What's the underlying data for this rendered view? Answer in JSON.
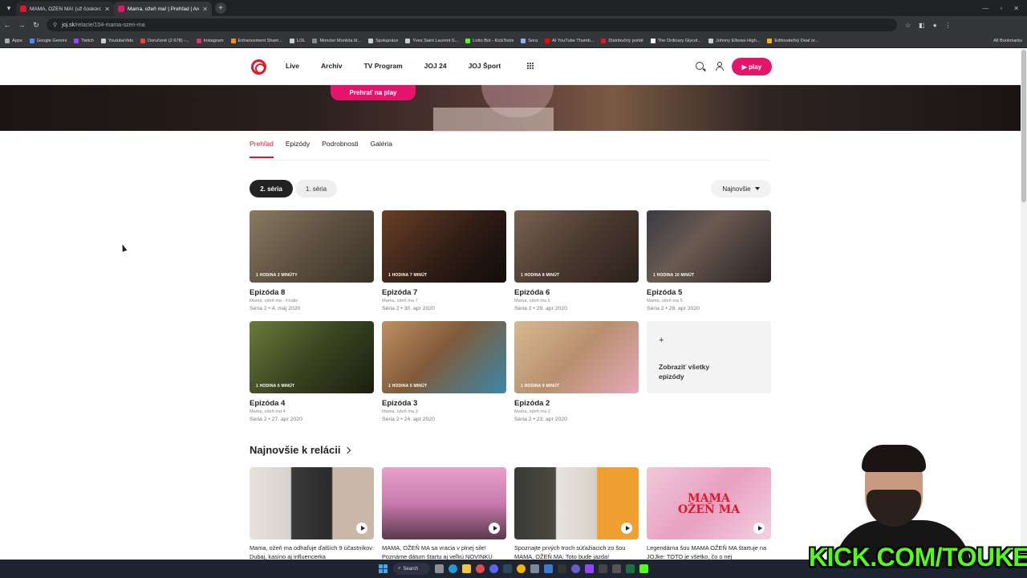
{
  "browser": {
    "tabs": [
      {
        "title": "MAMA, OŽEŇ MA! (už čoskoro",
        "active": false,
        "fav_color": "#e2162a"
      },
      {
        "title": "Mama, ožeň ma! | Prehľad | Arc",
        "active": true,
        "fav_color": "#e6156c"
      }
    ],
    "url_host": "joj.sk",
    "url_path": "/relacie/104-mama-ozen-ma",
    "bookmarks": [
      {
        "label": "Apps",
        "color": "#aaaaaa"
      },
      {
        "label": "Google Gemini",
        "color": "#4b8bf5"
      },
      {
        "label": "Twitch",
        "color": "#9146ff"
      },
      {
        "label": "YoutubeVids",
        "color": "#cccccc"
      },
      {
        "label": "Doručené (2 678) -...",
        "color": "#ea4335"
      },
      {
        "label": "Instagram",
        "color": "#e1306c"
      },
      {
        "label": "Enhancement Sham...",
        "color": "#f28b30"
      },
      {
        "label": "LOL",
        "color": "#cccccc"
      },
      {
        "label": "Moncler Montcla bl...",
        "color": "#888888"
      },
      {
        "label": "Spolupráce",
        "color": "#cccccc"
      },
      {
        "label": "Yves Saint Laurent S...",
        "color": "#cccccc"
      },
      {
        "label": "Lotto Bot - KickTools",
        "color": "#53fc18"
      },
      {
        "label": "Sora",
        "color": "#8ab4f8"
      },
      {
        "label": "AI YouTube Thumb...",
        "color": "#ff0000"
      },
      {
        "label": "Distribučný portál",
        "color": "#e2162a"
      },
      {
        "label": "The Ordinary Glycol...",
        "color": "#ffffff"
      },
      {
        "label": "Johnny Elbows High...",
        "color": "#cccccc"
      },
      {
        "label": "Editovateľný Deal or...",
        "color": "#f4b400"
      }
    ],
    "all_bookmarks": "All Bookmarks"
  },
  "header": {
    "nav": [
      "Live",
      "Archív",
      "TV Program",
      "JOJ 24",
      "JOJ Šport"
    ],
    "play_label": "play",
    "accent": "#e6156c",
    "brand_red": "#e2162a"
  },
  "hero": {
    "button_label": "Prehrať na  play"
  },
  "subtabs": [
    "Prehľad",
    "Epizódy",
    "Podrobnosti",
    "Galéria"
  ],
  "seasons": {
    "active": "2. séria",
    "other": "1. séria",
    "sort": "Najnovšie"
  },
  "episodes": [
    {
      "duration": "1 HODINA 2 MINÚTY",
      "title": "Epizóda 8",
      "sub": "Mama, ožeň ma · Finále",
      "meta": "Séria 2 • 4. máj 2020",
      "bg": "linear-gradient(135deg,#8a7a60,#5c5040 50%,#3a3026)"
    },
    {
      "duration": "1 HODINA 7 MINÚT",
      "title": "Epizóda 7",
      "sub": "Mama, ožeň ma 7",
      "meta": "Séria 2 • 30. apr 2020",
      "bg": "linear-gradient(135deg,#6a3f26,#2a1a14 60%,#120c0a)"
    },
    {
      "duration": "1 HODINA 8 MINÚT",
      "title": "Epizóda 6",
      "sub": "Mama, ožeň ma 6",
      "meta": "Séria 2 • 29. apr 2020",
      "bg": "linear-gradient(135deg,#7a6250,#4a3a30 50%,#2a201a)"
    },
    {
      "duration": "1 HODINA 10 MINÚT",
      "title": "Epizóda 5",
      "sub": "Mama, ožeň ma 5",
      "meta": "Séria 2 • 28. apr 2020",
      "bg": "linear-gradient(135deg,#3a3a44,#6a5a50 40%,#2a2226)"
    },
    {
      "duration": "1 HODINA 6 MINÚT",
      "title": "Epizóda 4",
      "sub": "Mama, ožeň ma 4",
      "meta": "Séria 2 • 27. apr 2020",
      "bg": "linear-gradient(135deg,#6a7a3a,#3a4420 50%,#1a1e10)"
    },
    {
      "duration": "1 HODINA 5 MINÚT",
      "title": "Epizóda 3",
      "sub": "Mama, ožeň ma 3",
      "meta": "Séria 2 • 24. apr 2020",
      "bg": "linear-gradient(135deg,#c09060,#805a3a 45%,#3a88a8)"
    },
    {
      "duration": "1 HODINA 9 MINÚT",
      "title": "Epizóda 2",
      "sub": "Mama, ožeň ma 2",
      "meta": "Séria 2 • 23. apr 2020",
      "bg": "linear-gradient(135deg,#d8b890,#b89070 50%,#e8a8b8)"
    }
  ],
  "show_all": {
    "plus": "+",
    "label": "Zobraziť všetky epizódy"
  },
  "latest": {
    "title": "Najnovšie k relácii",
    "items": [
      {
        "title": "Mama, ožeň ma odhaľuje ďalších 9 účastníkov: Dubaj, kasíno aj influencerka",
        "bg": "linear-gradient(90deg,#e8e2dc,#d8d2cc 33%,#3a3a3a 34%,#2a2a2a 66%,#c9b8a8 67%)"
      },
      {
        "title": "MAMA, OŽEŇ MA sa vracia v plnej sile! Poznáme dátum štartu aj veľkú NOVINKU",
        "bg": "linear-gradient(180deg,#e8a0c8,#c87ab0 50%,#5a3a4a)"
      },
      {
        "title": "Spoznajte prvých troch súťažiacich zo šou MAMA, OŽEŇ MA: Toto bude jazda!",
        "bg": "linear-gradient(90deg,#3a3a36,#4a4a40 33%,#e8e4e0 34%,#d8d0c8 66%,#f0a030 67%)"
      },
      {
        "title": "Legendárna šou MAMA OŽEŇ MA štartuje na JOJke: TOTO je všetko, čo o nej",
        "bg": "linear-gradient(135deg,#f0c8d8,#e8a0c0 50%,#f4d0e0)"
      }
    ],
    "logo_text": "MAMA OŽEŇ MA"
  },
  "taskbar": {
    "search_label": "Search"
  },
  "overlay": {
    "kick_text": "KICK.COM/TOUKEN"
  }
}
